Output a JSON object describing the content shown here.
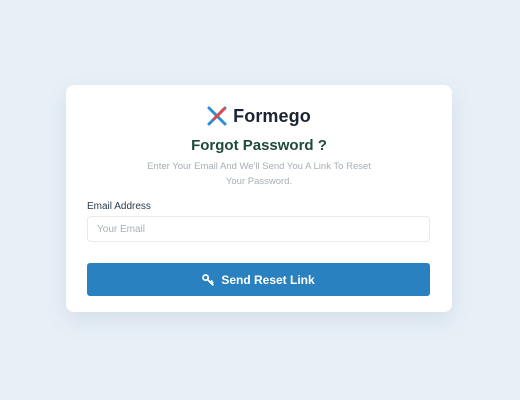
{
  "brand": {
    "name": "Formego",
    "logo_icon": "formego-logo-icon",
    "colors": {
      "blue": "#2a8ed3",
      "red": "#e24848"
    }
  },
  "form": {
    "title": "Forgot Password ?",
    "subtitle": "Enter Your Email And We'll Send You A Link To Reset Your Password.",
    "email_label": "Email Address",
    "email_placeholder": "Your Email",
    "email_value": "",
    "submit_label": "Send Reset Link",
    "submit_icon": "key-icon"
  },
  "colors": {
    "page_background": "#e8f0f7",
    "card_background": "#ffffff",
    "primary_button": "#2a81bf",
    "title_text": "#1f4a3a"
  }
}
